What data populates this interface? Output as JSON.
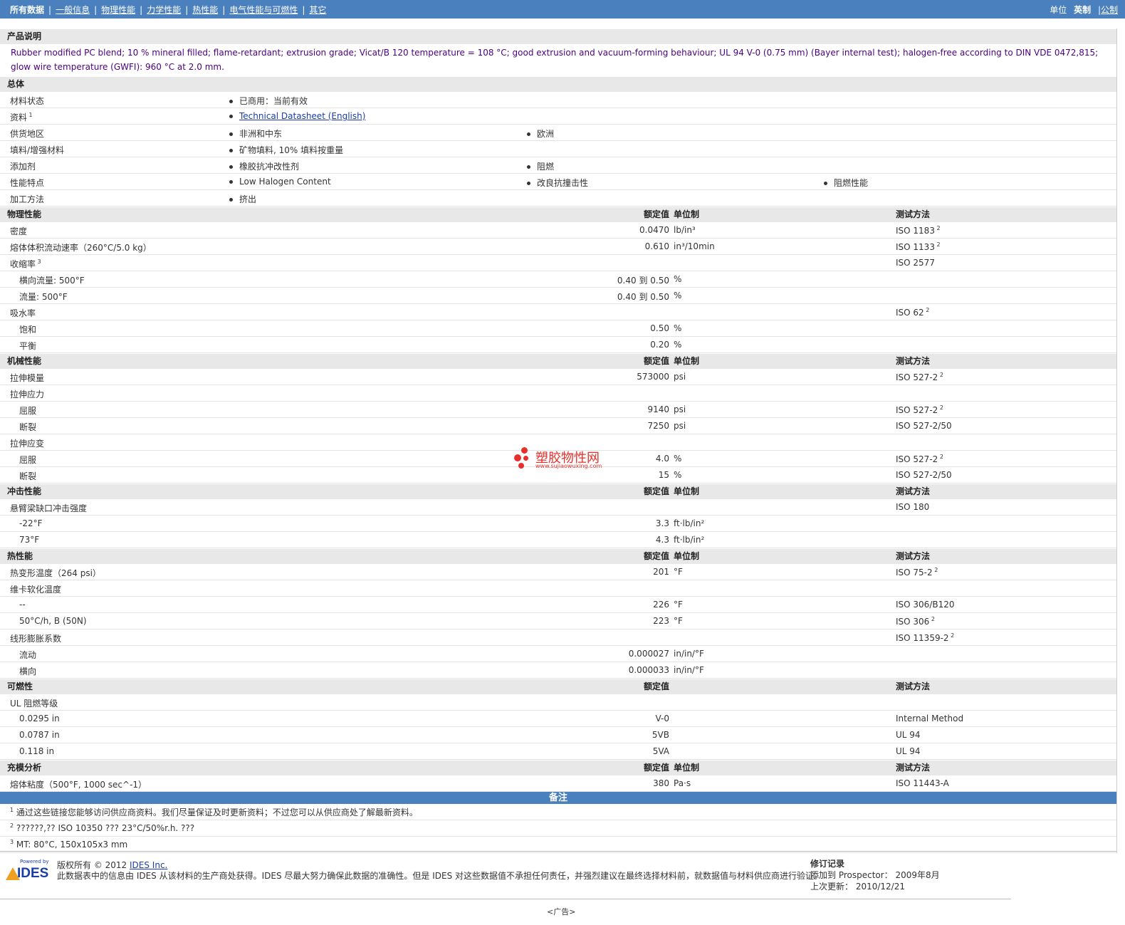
{
  "nav": {
    "items": [
      "所有数据",
      "一般信息",
      "物理性能",
      "力学性能",
      "热性能",
      "电气性能与可燃性",
      "其它"
    ],
    "units_label": "单位",
    "units_english": "英制",
    "units_metric": "公制"
  },
  "description": {
    "title": "产品说明",
    "text": "Rubber modified PC blend; 10 % mineral filled; flame-retardant; extrusion grade; Vicat/B 120 temperature = 108 °C; good extrusion and vacuum-forming behaviour; UL 94 V-0 (0.75 mm) (Bayer internal test); halogen-free according to DIN VDE 0472,815; glow wire temperature (GWFI): 960 °C at 2.0 mm."
  },
  "general": {
    "title": "总体",
    "rows": [
      {
        "name": "材料状态",
        "sup": "",
        "items": [
          "已商用：当前有效"
        ]
      },
      {
        "name": "资料",
        "sup": "1",
        "items": [
          "Technical Datasheet (English)"
        ]
      },
      {
        "name": "供货地区",
        "sup": "",
        "items": [
          "非洲和中东",
          "欧洲"
        ]
      },
      {
        "name": "填料/增强材料",
        "sup": "",
        "items": [
          "矿物填料, 10% 填料按重量"
        ]
      },
      {
        "name": "添加剂",
        "sup": "",
        "items": [
          "橡胶抗冲改性剂",
          "阻燃"
        ]
      },
      {
        "name": "性能特点",
        "sup": "",
        "items": [
          "Low Halogen Content",
          "改良抗撞击性",
          "阻燃性能"
        ]
      },
      {
        "name": "加工方法",
        "sup": "",
        "items": [
          "挤出"
        ]
      }
    ]
  },
  "headers": {
    "value": "额定值",
    "unit": "单位制",
    "method": "测试方法"
  },
  "physical": {
    "title": "物理性能",
    "rows": [
      {
        "name": "密度",
        "sub": false,
        "sup": "",
        "value": "0.0470",
        "unit": "lb/in³",
        "method": "ISO 1183",
        "msup": "2"
      },
      {
        "name": "熔体体积流动速率（260°C/5.0 kg）",
        "sub": false,
        "sup": "",
        "value": "0.610",
        "unit": "in³/10min",
        "method": "ISO 1133",
        "msup": "2"
      },
      {
        "name": "收缩率",
        "sub": false,
        "sup": "3",
        "value": "",
        "unit": "",
        "method": "ISO 2577",
        "msup": ""
      },
      {
        "name": "横向流量: 500°F",
        "sub": true,
        "sup": "",
        "value": "0.40 到  0.50",
        "unit": "%",
        "method": "",
        "msup": ""
      },
      {
        "name": "流量: 500°F",
        "sub": true,
        "sup": "",
        "value": "0.40 到  0.50",
        "unit": "%",
        "method": "",
        "msup": ""
      },
      {
        "name": "吸水率",
        "sub": false,
        "sup": "",
        "value": "",
        "unit": "",
        "method": "ISO 62",
        "msup": "2"
      },
      {
        "name": "饱和",
        "sub": true,
        "sup": "",
        "value": "0.50",
        "unit": "%",
        "method": "",
        "msup": ""
      },
      {
        "name": "平衡",
        "sub": true,
        "sup": "",
        "value": "0.20",
        "unit": "%",
        "method": "",
        "msup": ""
      }
    ]
  },
  "mechanical": {
    "title": "机械性能",
    "rows": [
      {
        "name": "拉伸模量",
        "sub": false,
        "sup": "",
        "value": "573000",
        "unit": "psi",
        "method": "ISO 527-2",
        "msup": "2"
      },
      {
        "name": "拉伸应力",
        "sub": false,
        "sup": "",
        "value": "",
        "unit": "",
        "method": "",
        "msup": ""
      },
      {
        "name": "屈服",
        "sub": true,
        "sup": "",
        "value": "9140",
        "unit": "psi",
        "method": "ISO 527-2",
        "msup": "2"
      },
      {
        "name": "断裂",
        "sub": true,
        "sup": "",
        "value": "7250",
        "unit": "psi",
        "method": "ISO 527-2/50",
        "msup": ""
      },
      {
        "name": "拉伸应变",
        "sub": false,
        "sup": "",
        "value": "",
        "unit": "",
        "method": "",
        "msup": ""
      },
      {
        "name": "屈服",
        "sub": true,
        "sup": "",
        "value": "4.0",
        "unit": "%",
        "method": "ISO 527-2",
        "msup": "2"
      },
      {
        "name": "断裂",
        "sub": true,
        "sup": "",
        "value": "15",
        "unit": "%",
        "method": "ISO 527-2/50",
        "msup": ""
      }
    ]
  },
  "impact": {
    "title": "冲击性能",
    "rows": [
      {
        "name": "悬臂梁缺口冲击强度",
        "sub": false,
        "sup": "",
        "value": "",
        "unit": "",
        "method": "ISO 180",
        "msup": ""
      },
      {
        "name": "-22°F",
        "sub": true,
        "sup": "",
        "value": "3.3",
        "unit": "ft·lb/in²",
        "method": "",
        "msup": ""
      },
      {
        "name": "73°F",
        "sub": true,
        "sup": "",
        "value": "4.3",
        "unit": "ft·lb/in²",
        "method": "",
        "msup": ""
      }
    ]
  },
  "thermal": {
    "title": "热性能",
    "rows": [
      {
        "name": "热变形温度（264 psi）",
        "sub": false,
        "sup": "",
        "value": "201",
        "unit": "°F",
        "method": "ISO 75-2",
        "msup": "2"
      },
      {
        "name": "维卡软化温度",
        "sub": false,
        "sup": "",
        "value": "",
        "unit": "",
        "method": "",
        "msup": ""
      },
      {
        "name": "--",
        "sub": true,
        "sup": "",
        "value": "226",
        "unit": "°F",
        "method": "ISO 306/B120",
        "msup": ""
      },
      {
        "name": "50°C/h, B (50N)",
        "sub": true,
        "sup": "",
        "value": "223",
        "unit": "°F",
        "method": "ISO 306",
        "msup": "2"
      },
      {
        "name": "线形膨胀系数",
        "sub": false,
        "sup": "",
        "value": "",
        "unit": "",
        "method": "ISO 11359-2",
        "msup": "2"
      },
      {
        "name": "流动",
        "sub": true,
        "sup": "",
        "value": "0.000027",
        "unit": "in/in/°F",
        "method": "",
        "msup": ""
      },
      {
        "name": "横向",
        "sub": true,
        "sup": "",
        "value": "0.000033",
        "unit": "in/in/°F",
        "method": "",
        "msup": ""
      }
    ]
  },
  "flammability": {
    "title": "可燃性",
    "rows": [
      {
        "name": "UL 阻燃等级",
        "sub": false,
        "purple": false,
        "value": "",
        "method": ""
      },
      {
        "name": "0.0295 in",
        "sub": true,
        "purple": true,
        "value": "V-0",
        "method": "Internal Method"
      },
      {
        "name": "0.0787 in",
        "sub": true,
        "purple": true,
        "value": "5VB",
        "method": "UL 94"
      },
      {
        "name": "0.118 in",
        "sub": true,
        "purple": true,
        "value": "5VA",
        "method": "UL 94"
      }
    ]
  },
  "filling": {
    "title": "充模分析",
    "rows": [
      {
        "name": "熔体粘度（500°F, 1000 sec^-1）",
        "sub": false,
        "sup": "",
        "value": "380",
        "unit": "Pa·s",
        "method": "ISO 11443-A",
        "msup": ""
      }
    ]
  },
  "notes": {
    "title": "备注",
    "items": [
      {
        "num": "1",
        "text": "通过这些链接您能够访问供应商资料。我们尽量保证及时更新资料；不过您可以从供应商处了解最新资料。"
      },
      {
        "num": "2",
        "text": "??????,?? ISO 10350 ??? 23°C/50%r.h. ???"
      },
      {
        "num": "3",
        "text": "MT: 80°C, 150x105x3 mm"
      }
    ]
  },
  "footer": {
    "logo_powered": "Powered by",
    "logo_name": "IDES",
    "copyright_prefix": "版权所有 © 2012",
    "copyright_link": "IDES Inc.",
    "disclaimer": "此数据表中的信息由 IDES 从该材料的生产商处获得。IDES 尽最大努力确保此数据的准确性。但是 IDES 对这些数据值不承担任何责任，并强烈建议在最终选择材料前，就数据值与材料供应商进行验证。",
    "rev_title": "修订记录",
    "rev_added": "添加到 Prospector： 2009年8月",
    "rev_updated": "上次更新： 2010/12/21",
    "ad": "<广告>"
  },
  "watermark": {
    "title": "塑胶物性网",
    "url": "www.sujiaowuxing.com"
  }
}
